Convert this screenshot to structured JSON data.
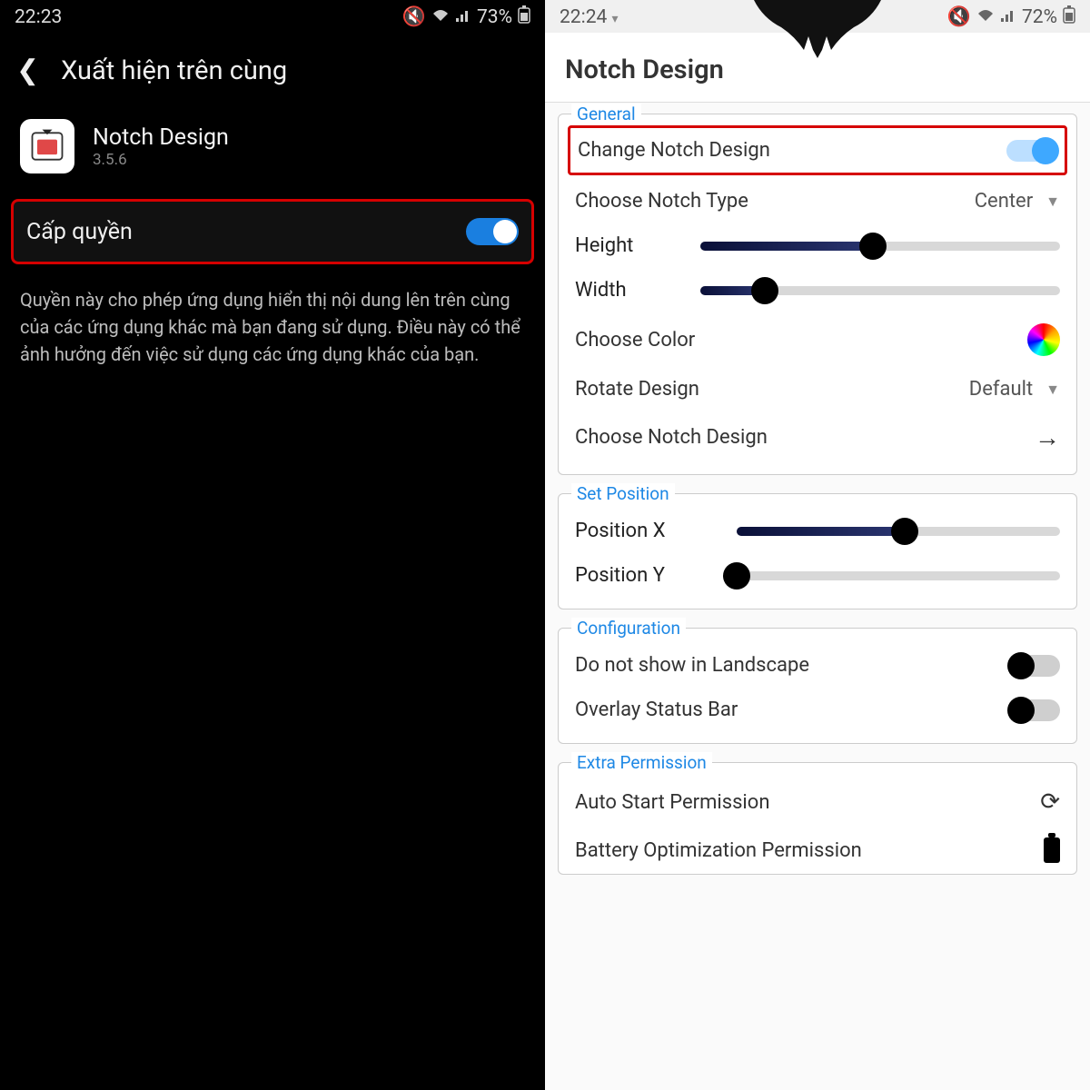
{
  "left": {
    "status": {
      "time": "22:23",
      "battery": "73%"
    },
    "header_title": "Xuất hiện trên cùng",
    "app": {
      "name": "Notch Design",
      "version": "3.5.6"
    },
    "permission": {
      "label": "Cấp quyền",
      "enabled": true
    },
    "description": "Quyền này cho phép ứng dụng hiển thị nội dung lên trên cùng của các ứng dụng khác mà bạn đang sử dụng. Điều này có thể ảnh hưởng đến việc sử dụng các ứng dụng khác của bạn."
  },
  "right": {
    "status": {
      "time": "22:24",
      "battery": "72%"
    },
    "app_title": "Notch Design",
    "general": {
      "title": "General",
      "change_design": {
        "label": "Change Notch Design",
        "enabled": true
      },
      "choose_type": {
        "label": "Choose Notch Type",
        "value": "Center"
      },
      "height": {
        "label": "Height",
        "percent": 48
      },
      "width": {
        "label": "Width",
        "percent": 18
      },
      "choose_color": {
        "label": "Choose Color"
      },
      "rotate": {
        "label": "Rotate Design",
        "value": "Default"
      },
      "choose_notch": {
        "label": "Choose Notch Design"
      }
    },
    "set_position": {
      "title": "Set Position",
      "x": {
        "label": "Position X",
        "percent": 52
      },
      "y": {
        "label": "Position Y",
        "percent": 0
      }
    },
    "configuration": {
      "title": "Configuration",
      "landscape": {
        "label": "Do not show in Landscape",
        "enabled": false
      },
      "overlay": {
        "label": "Overlay Status Bar",
        "enabled": false
      }
    },
    "extra": {
      "title": "Extra Permission",
      "autostart": {
        "label": "Auto Start Permission"
      },
      "battery": {
        "label": "Battery Optimization Permission"
      }
    }
  }
}
